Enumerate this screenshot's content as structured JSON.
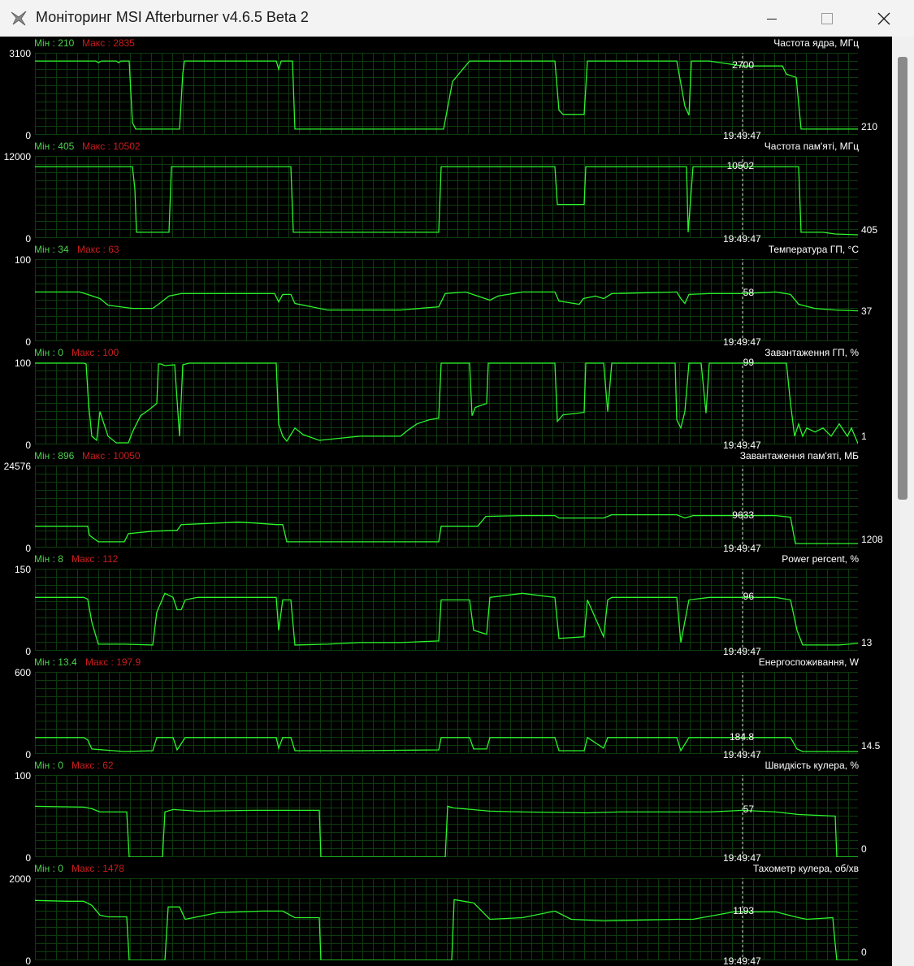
{
  "window": {
    "title": "Моніторинг MSI Afterburner v4.6.5 Beta 2",
    "icons": {
      "app": "afterburner-plane-icon",
      "minimize": "minimize-icon",
      "maximize": "maximize-icon",
      "close": "close-icon"
    }
  },
  "colors": {
    "line": "#2cf52c",
    "grid": "#0e3b0e",
    "min_label": "#4dd14d",
    "max_label": "#c91d1d",
    "background": "#000000",
    "marker": "#d8d8d8"
  },
  "graphs": [
    {
      "title": "Частота ядра, МГц",
      "min_label": "Мін : 210",
      "max_label": "Макс : 2835",
      "axis_max": "3100",
      "axis_min": "0",
      "current": "2700",
      "time": "19:49:47",
      "end_value": "210"
    },
    {
      "title": "Частота пам'яті, МГц",
      "min_label": "Мін : 405",
      "max_label": "Макс : 10502",
      "axis_max": "12000",
      "axis_min": "0",
      "current": "10502",
      "time": "19:49:47",
      "end_value": "405"
    },
    {
      "title": "Температура ГП, °C",
      "min_label": "Мін : 34",
      "max_label": "Макс : 63",
      "axis_max": "100",
      "axis_min": "0",
      "current": "58",
      "time": "19:49:47",
      "end_value": "37"
    },
    {
      "title": "Завантаження ГП, %",
      "min_label": "Мін : 0",
      "max_label": "Макс : 100",
      "axis_max": "100",
      "axis_min": "0",
      "current": "99",
      "time": "19:49:47",
      "end_value": "1"
    },
    {
      "title": "Завантаження пам'яті, МБ",
      "min_label": "Мін : 896",
      "max_label": "Макс : 10050",
      "axis_max": "24576",
      "axis_min": "0",
      "current": "9633",
      "time": "19:49:47",
      "end_value": "1208"
    },
    {
      "title": "Power percent, %",
      "min_label": "Мін : 8",
      "max_label": "Макс : 112",
      "axis_max": "150",
      "axis_min": "0",
      "current": "96",
      "time": "19:49:47",
      "end_value": "13"
    },
    {
      "title": "Енергоспоживання, W",
      "min_label": "Мін : 13.4",
      "max_label": "Макс : 197.9",
      "axis_max": "600",
      "axis_min": "0",
      "current": "184.8",
      "time": "19:49:47",
      "end_value": "14.5"
    },
    {
      "title": "Швидкість кулера, %",
      "min_label": "Мін : 0",
      "max_label": "Макс : 62",
      "axis_max": "100",
      "axis_min": "0",
      "current": "57",
      "time": "19:49:47",
      "end_value": "0"
    },
    {
      "title": "Тахометр кулера, об/хв",
      "min_label": "Мін : 0",
      "max_label": "Макс : 1478",
      "axis_max": "2000",
      "axis_min": "0",
      "current": "1193",
      "time": "19:49:47",
      "end_value": "0"
    }
  ]
}
